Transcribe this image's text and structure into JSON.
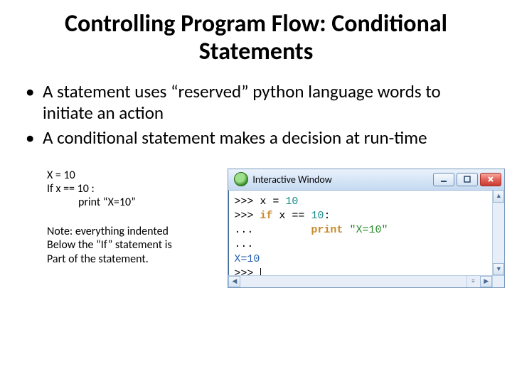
{
  "title": "Controlling Program Flow: Conditional Statements",
  "bullets": [
    "A statement uses “reserved” python language words to initiate an action",
    "A conditional statement makes a decision at run-time"
  ],
  "code_sample": {
    "line1": "X = 10",
    "line2": "If x == 10 :",
    "line3": "print “X=10”"
  },
  "note": {
    "l1": "Note: everything indented",
    "l2": "Below the “If” statement is",
    "l3": "Part of the statement."
  },
  "window": {
    "title": "Interactive Window",
    "terminal": {
      "p1": ">>> ",
      "p2": "... ",
      "assign_lhs": "x = ",
      "assign_val": "10",
      "if_kw": "if",
      "if_rest_a": " x == ",
      "if_rest_b": "10",
      "if_rest_c": ":",
      "print_indent": "        ",
      "print_kw": "print",
      "print_sp": " ",
      "print_str": "\"X=10\"",
      "blank": "",
      "out": "X=10"
    }
  }
}
